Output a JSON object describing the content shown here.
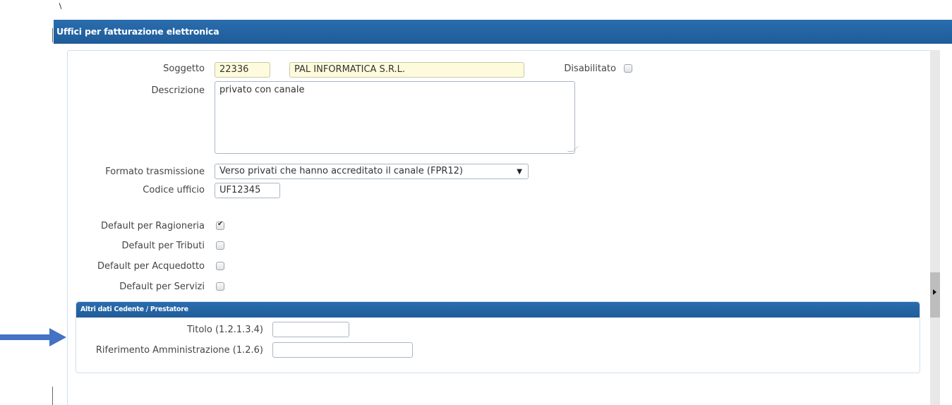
{
  "panel": {
    "title": "Uffici per fatturazione elettronica"
  },
  "form": {
    "soggetto": {
      "label": "Soggetto",
      "code": "22336",
      "name": "PAL INFORMATICA S.R.L."
    },
    "disabilitato": {
      "label": "Disabilitato",
      "checked": false
    },
    "descrizione": {
      "label": "Descrizione",
      "value": "privato con canale"
    },
    "formato_trasmissione": {
      "label": "Formato trasmissione",
      "selected": "Verso privati che hanno accreditato il canale (FPR12)"
    },
    "codice_ufficio": {
      "label": "Codice ufficio",
      "value": "UF12345"
    },
    "defaults": [
      {
        "label": "Default per Ragioneria",
        "checked": true
      },
      {
        "label": "Default per Tributi",
        "checked": false
      },
      {
        "label": "Default per Acquedotto",
        "checked": false
      },
      {
        "label": "Default per Servizi",
        "checked": false
      }
    ]
  },
  "altri_dati": {
    "title": "Altri dati Cedente / Prestatore",
    "titolo": {
      "label": "Titolo (1.2.1.3.4)",
      "value": ""
    },
    "riferimento": {
      "label": "Riferimento Amministrazione (1.2.6)",
      "value": ""
    }
  },
  "colors": {
    "header_blue": "#1f5c9a",
    "readonly_bg": "#fdfbdc",
    "arrow": "#4472c4"
  }
}
